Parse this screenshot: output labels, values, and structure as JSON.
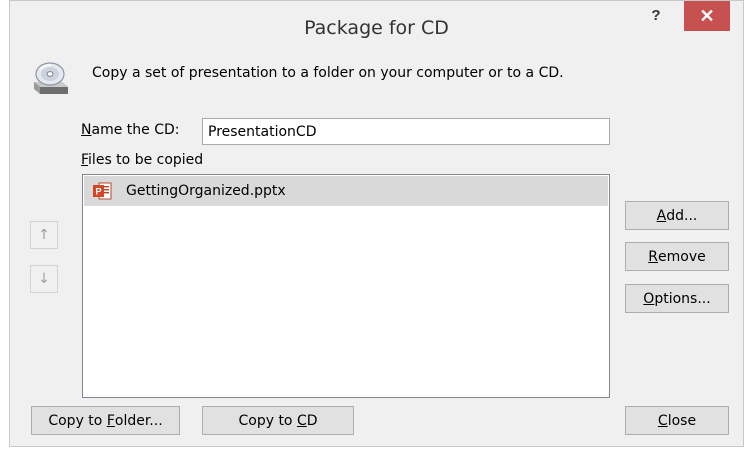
{
  "window": {
    "title": "Package for CD",
    "help_label": "?",
    "close_glyph": "✕",
    "close_color": "#c75050"
  },
  "description": "Copy a set of presentation to a folder on your computer or to a CD.",
  "name_field": {
    "label_mnemonic": "N",
    "label_rest": "ame the CD:",
    "value": "PresentationCD"
  },
  "files": {
    "label_mnemonic": "F",
    "label_rest": "iles to be copied",
    "items": [
      {
        "name": "GettingOrganized.pptx",
        "icon": "powerpoint-file-icon",
        "selected": true
      }
    ]
  },
  "reorder": {
    "up_glyph": "↑",
    "down_glyph": "↓"
  },
  "buttons": {
    "add": {
      "mnemonic": "A",
      "rest": "dd..."
    },
    "remove": {
      "pre": "",
      "mnemonic": "R",
      "rest": "emove"
    },
    "options": {
      "mnemonic": "O",
      "rest": "ptions..."
    },
    "copy_to_folder": {
      "pre": "Copy to ",
      "mnemonic": "F",
      "rest": "older..."
    },
    "copy_to_cd": {
      "pre": "Copy to ",
      "mnemonic": "C",
      "rest": "D"
    },
    "close": {
      "mnemonic": "C",
      "rest": "lose"
    }
  }
}
